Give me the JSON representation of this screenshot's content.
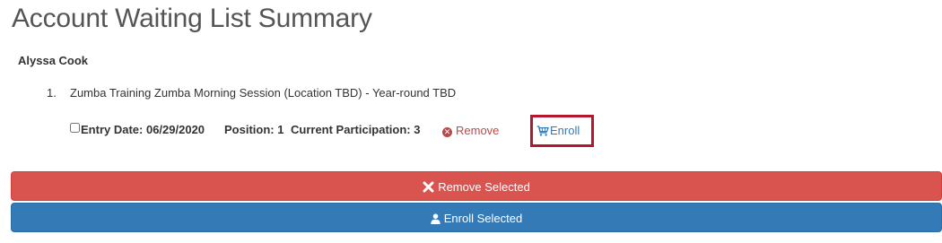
{
  "page": {
    "title": "Account Waiting List Summary"
  },
  "account": {
    "name": "Alyssa Cook"
  },
  "waiting_list": {
    "items": [
      {
        "number": "1.",
        "title": "Zumba Training Zumba Morning Session (Location TBD) - Year-round TBD",
        "entry_date": "Entry Date: 06/29/2020",
        "position": "Position: 1",
        "current_participation": "Current Participation: 3",
        "remove_label": "Remove",
        "enroll_label": "Enroll",
        "checked": false
      }
    ]
  },
  "actions": {
    "remove_selected_label": "Remove Selected",
    "enroll_selected_label": "Enroll Selected"
  },
  "icons": {
    "remove": "times-circle-icon",
    "enroll": "shopping-cart-icon",
    "remove_selected": "times-icon",
    "enroll_selected": "user-icon"
  },
  "colors": {
    "remove_red": "#d9534f",
    "remove_link_red": "#b94a48",
    "enroll_blue": "#337ab7",
    "highlight_border": "#b5172f"
  }
}
